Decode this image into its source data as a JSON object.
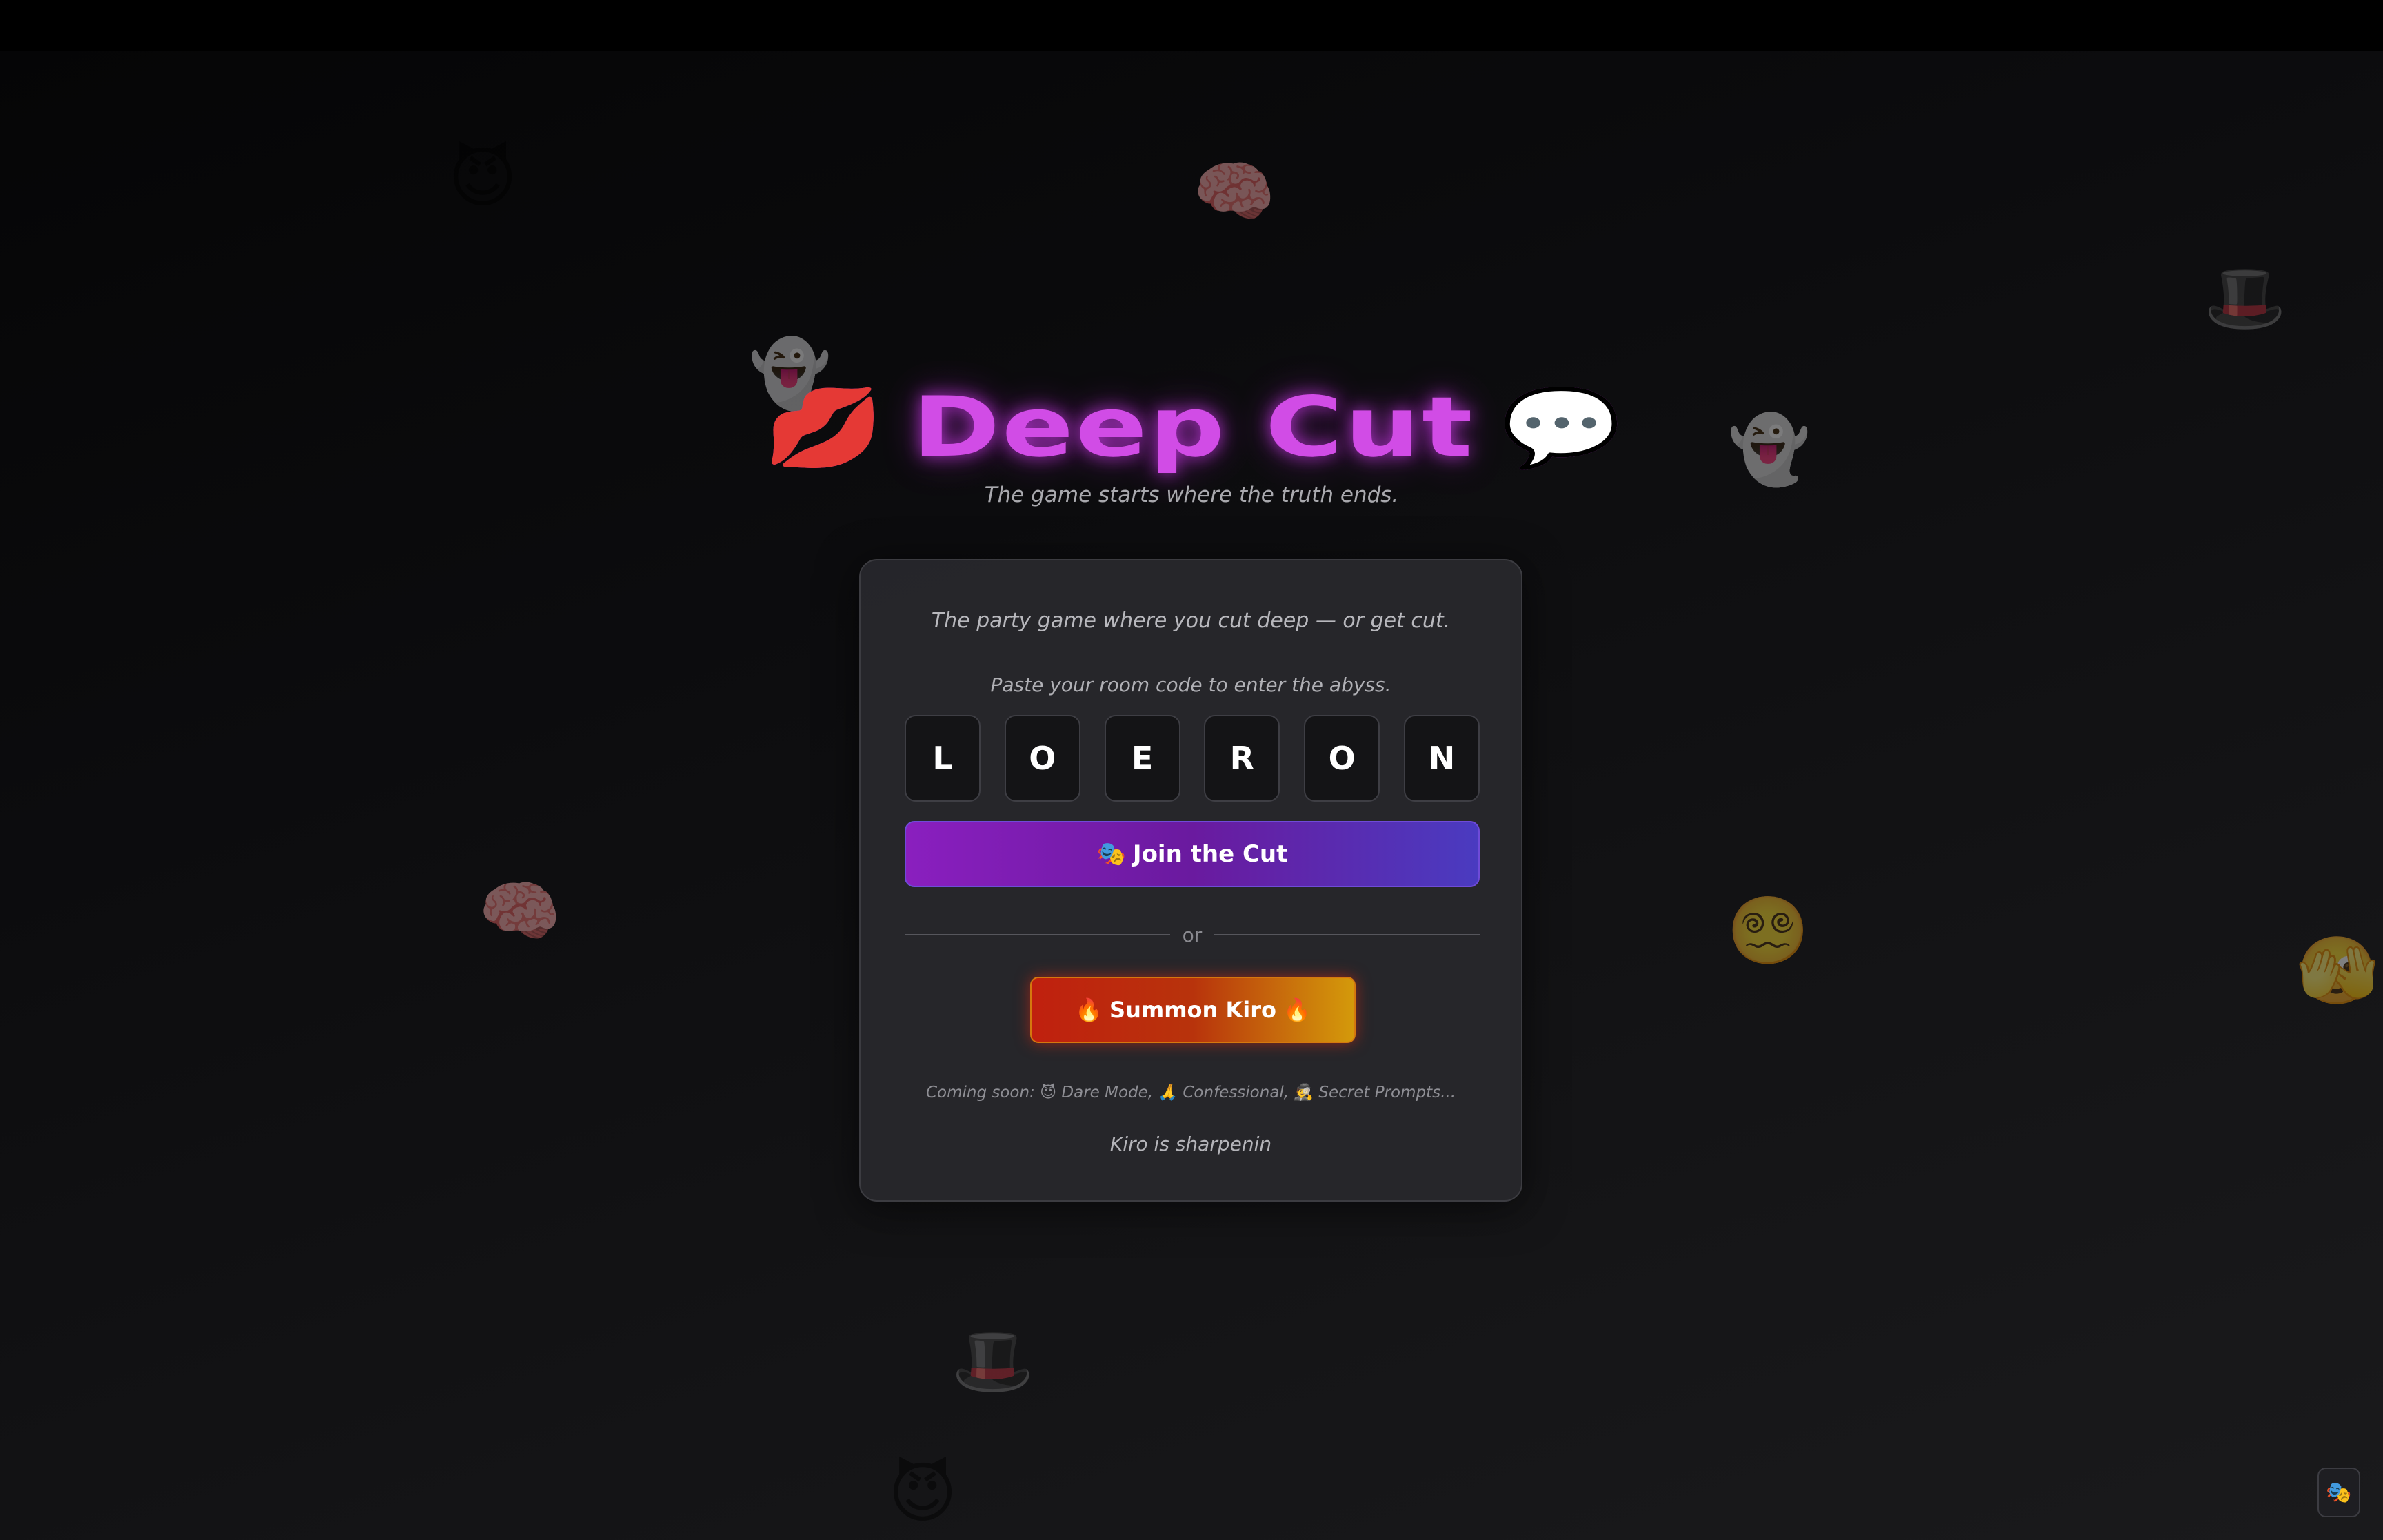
{
  "header": {
    "title": "Deep Cut",
    "title_left_emoji": "💋",
    "title_right_emoji": "💬",
    "subtitle": "The game starts where the truth ends."
  },
  "card": {
    "tagline": "The party game where you cut deep — or get cut.",
    "prompt": "Paste your room code to enter the abyss.",
    "room_code": [
      "L",
      "O",
      "E",
      "R",
      "O",
      "N"
    ],
    "join_button": {
      "icon": "🎭",
      "label": "Join the Cut"
    },
    "divider_text": "or",
    "summon_button": {
      "icon_left": "🔥",
      "label": "Summon Kiro",
      "icon_right": "🔥"
    },
    "coming_soon": "Coming soon: 😈 Dare Mode, 🙏 Confessional, 🕵️ Secret Prompts...",
    "status": "Kiro is sharpenin"
  },
  "floaters": {
    "devil_1": "😈",
    "brain_1": "🧠",
    "top_hat_1": "🎩",
    "ghost_1": "👻",
    "ghost_2": "👻",
    "brain_2": "🧠",
    "dizzy_face": "😵‍💫",
    "sly_face": "🫣",
    "top_hat_2": "🎩",
    "devil_2": "😈"
  },
  "corner_button": {
    "icon": "🎭"
  },
  "colors": {
    "title": "#d14ce6",
    "join_gradient_start": "#8a1fbf",
    "join_gradient_end": "#4a3bc0",
    "summon_gradient_start": "#c0200e",
    "summon_gradient_end": "#d49a0b"
  }
}
